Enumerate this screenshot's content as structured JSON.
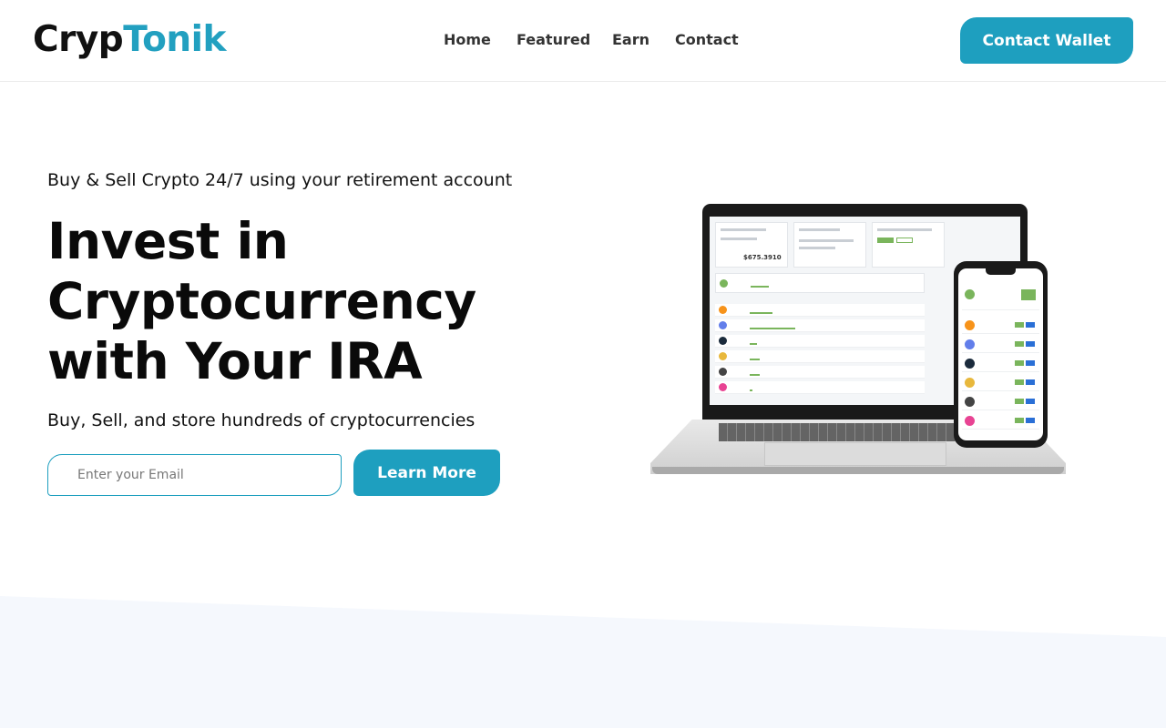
{
  "brand": {
    "part1": "Cryp",
    "part2": "Tonik"
  },
  "nav": {
    "items": [
      "Home",
      "Featured",
      "Earn",
      "Contact"
    ]
  },
  "header": {
    "wallet_button": "Contact Wallet"
  },
  "hero": {
    "subtitle": "Buy & Sell Crypto 24/7 using your retirement account",
    "headline_lines": [
      "Invest in",
      "Cryptocurrency",
      "with Your IRA"
    ],
    "tagline": "Buy, Sell, and store hundreds of cryptocurrencies",
    "email_placeholder": "Enter your Email",
    "cta_button": "Learn More"
  },
  "mockup": {
    "portfolio_value": "$675.3910",
    "coins": [
      {
        "color": "#f7931a",
        "bar": 0.45
      },
      {
        "color": "#627eea",
        "bar": 0.9
      },
      {
        "color": "#1b2b3c",
        "bar": 0.15
      },
      {
        "color": "#e8b83c",
        "bar": 0.2
      },
      {
        "color": "#444444",
        "bar": 0.2
      },
      {
        "color": "#e84393",
        "bar": 0.05
      }
    ],
    "accent": "#7ab55c",
    "phone_button_blue": "#2a6fd6"
  },
  "colors": {
    "accent": "#1e9fbf",
    "bottom_band": "#f5f8fd"
  }
}
